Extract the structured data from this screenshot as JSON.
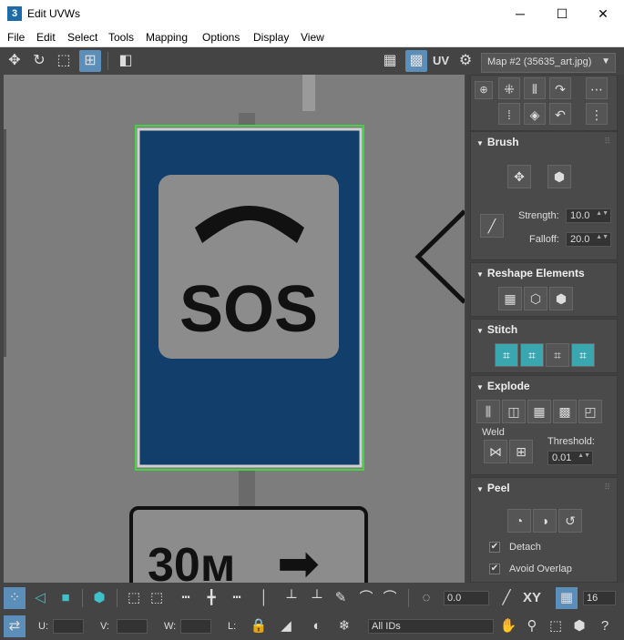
{
  "window": {
    "app_icon": "3",
    "title": "Edit UVWs",
    "minimize": "─",
    "maximize": "☐",
    "close": "✕"
  },
  "menu": [
    "File",
    "Edit",
    "Select",
    "Tools",
    "Mapping",
    "Options",
    "Display",
    "View"
  ],
  "toolbar": {
    "uv_label": "UV",
    "map_dropdown": "Map #2 (35635_art.jpg)",
    "dropdown_arrow": "▼"
  },
  "viewport": {
    "sign_main_text": "SOS",
    "sign_lower_text": "30м",
    "arrow": "➡"
  },
  "panel": {
    "brush": {
      "header": "Brush",
      "strength_label": "Strength:",
      "strength_value": "10.0",
      "falloff_label": "Falloff:",
      "falloff_value": "20.0"
    },
    "reshape": {
      "header": "Reshape Elements"
    },
    "stitch": {
      "header": "Stitch"
    },
    "explode": {
      "header": "Explode",
      "weld_label": "Weld",
      "threshold_label": "Threshold:",
      "threshold_value": "0.01"
    },
    "peel": {
      "header": "Peel",
      "detach_label": "Detach",
      "avoid_overlap_label": "Avoid Overlap",
      "check_mark": "✔"
    }
  },
  "bottom": {
    "angle_value": "0.0",
    "xy_label": "XY",
    "grid_value": "16",
    "u_label": "U:",
    "v_label": "V:",
    "w_label": "W:",
    "l_label": "L:",
    "ids_dropdown": "All IDs"
  },
  "colors": {
    "sign_blue": "#123e6b",
    "sign_panel": "#8c8c8c",
    "viewport_bg": "#7d7d7d",
    "selection_green": "#45d345",
    "accent_teal": "#3fc1c9",
    "active_blue": "#5b8fb9"
  }
}
